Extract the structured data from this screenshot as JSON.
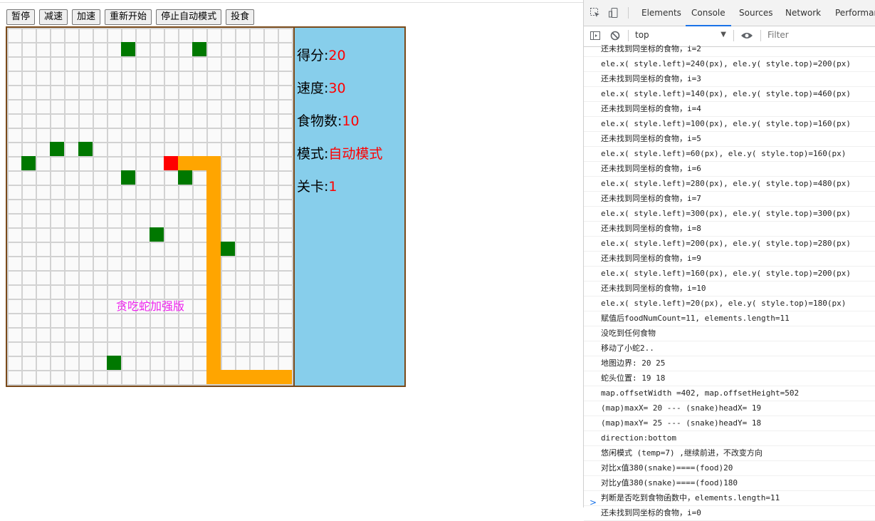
{
  "controls": [
    "暂停",
    "减速",
    "加速",
    "重新开始",
    "停止自动模式",
    "投食"
  ],
  "stats": {
    "score_label": "得分:",
    "score": "20",
    "speed_label": "速度:",
    "speed": "30",
    "food_label": "食物数:",
    "food": "10",
    "mode_label": "模式:",
    "mode": "自动模式",
    "level_label": "关卡:",
    "level": "1"
  },
  "watermark": "贪吃蛇加强版",
  "grid": {
    "cols": 20,
    "rows": 25
  },
  "food_cells": [
    [
      8,
      1
    ],
    [
      13,
      1
    ],
    [
      3,
      8
    ],
    [
      5,
      8
    ],
    [
      1,
      9
    ],
    [
      8,
      10
    ],
    [
      12,
      10
    ],
    [
      10,
      14
    ],
    [
      15,
      15
    ],
    [
      7,
      23
    ]
  ],
  "snake_head": [
    11,
    9
  ],
  "snake_body": [
    [
      12,
      9
    ],
    [
      13,
      9
    ],
    [
      14,
      9
    ],
    [
      14,
      10
    ],
    [
      14,
      11
    ],
    [
      14,
      12
    ],
    [
      14,
      13
    ],
    [
      14,
      14
    ],
    [
      14,
      15
    ],
    [
      14,
      16
    ],
    [
      14,
      17
    ],
    [
      14,
      18
    ],
    [
      14,
      19
    ],
    [
      14,
      20
    ],
    [
      14,
      21
    ],
    [
      14,
      22
    ],
    [
      14,
      23
    ],
    [
      14,
      24
    ],
    [
      15,
      24
    ],
    [
      16,
      24
    ],
    [
      17,
      24
    ],
    [
      18,
      24
    ],
    [
      19,
      24
    ]
  ],
  "colors": {
    "food": "#007800",
    "head": "#ff0000",
    "body": "#ffa500",
    "panel": "#87ceeb",
    "map_border": "#7a4a1a"
  },
  "devtools": {
    "tabs": [
      "Elements",
      "Console",
      "Sources",
      "Network",
      "Performanc"
    ],
    "active_tab": "Console",
    "context": "top",
    "filter_placeholder": "Filter",
    "icons": [
      "inspect-icon",
      "device-toolbar-icon",
      "sidebar-toggle-icon",
      "clear-console-icon",
      "eye-icon"
    ],
    "logs": [
      "还未找到同坐标的食物，i=2",
      "ele.x( style.left)=240(px), ele.y( style.top)=200(px)",
      "还未找到同坐标的食物，i=3",
      "ele.x( style.left)=140(px), ele.y( style.top)=460(px)",
      "还未找到同坐标的食物，i=4",
      "ele.x( style.left)=100(px), ele.y( style.top)=160(px)",
      "还未找到同坐标的食物，i=5",
      "ele.x( style.left)=60(px), ele.y( style.top)=160(px)",
      "还未找到同坐标的食物，i=6",
      "ele.x( style.left)=280(px), ele.y( style.top)=480(px)",
      "还未找到同坐标的食物，i=7",
      "ele.x( style.left)=300(px), ele.y( style.top)=300(px)",
      "还未找到同坐标的食物，i=8",
      "ele.x( style.left)=200(px), ele.y( style.top)=280(px)",
      "还未找到同坐标的食物，i=9",
      "ele.x( style.left)=160(px), ele.y( style.top)=200(px)",
      "还未找到同坐标的食物，i=10",
      "ele.x( style.left)=20(px), ele.y( style.top)=180(px)",
      "赋值后foodNumCount=11, elements.length=11",
      "没吃到任何食物",
      "移动了小蛇2..",
      "地图边界: 20 25",
      "蛇头位置: 19 18",
      "map.offsetWidth =402, map.offsetHeight=502",
      "(map)maxX= 20 --- (snake)headX= 19",
      "(map)maxY= 25 --- (snake)headY= 18",
      "direction:bottom",
      "悠闲模式 (temp=7) ,继续前进，不改变方向",
      "对比x值380(snake)====(food)20",
      "对比y值380(snake)====(food)180",
      "判断是否吃到食物函数中，elements.length=11",
      "还未找到同坐标的食物，i=0"
    ],
    "prompt": ">"
  }
}
